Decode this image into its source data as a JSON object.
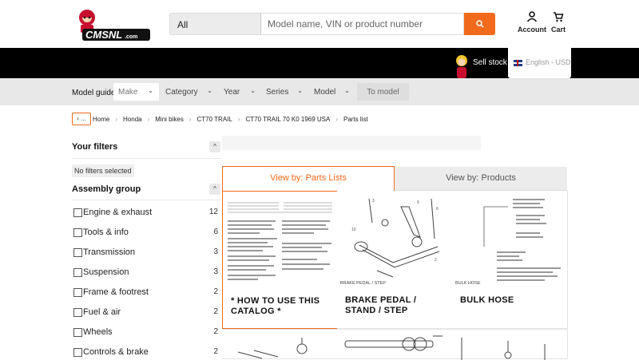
{
  "header": {
    "logo_text": "CMSNL.com",
    "search": {
      "category": "All",
      "placeholder": "Model name, VIN or product number"
    },
    "account_label": "Account",
    "cart_label": "Cart",
    "accent_color": "#f26a1b"
  },
  "topbar": {
    "sell_stock": "Sell stock",
    "language": "English - USD"
  },
  "model_guide": {
    "label": "Model guide",
    "selects": [
      "Make",
      "Category",
      "Year",
      "Series",
      "Model"
    ],
    "to_model": "To model"
  },
  "breadcrumb": {
    "back": "‹ ...",
    "items": [
      "Home",
      "Honda",
      "Mini bikes",
      "CT70 TRAIL",
      "CT70 TRAIL 70 K0 1969 USA",
      "Parts list"
    ]
  },
  "sidebar": {
    "filters_title": "Your filters",
    "no_filters": "No filters selected",
    "assembly_title": "Assembly group",
    "groups": [
      {
        "label": "Engine & exhaust",
        "count": "12"
      },
      {
        "label": "Tools & info",
        "count": "6"
      },
      {
        "label": "Transmission",
        "count": "3"
      },
      {
        "label": "Suspension",
        "count": "3"
      },
      {
        "label": "Frame & footrest",
        "count": "2"
      },
      {
        "label": "Fuel & air",
        "count": "2"
      },
      {
        "label": "Wheels",
        "count": "2"
      },
      {
        "label": "Controls & brake",
        "count": "2"
      }
    ]
  },
  "main": {
    "tabs": {
      "parts_lists": "View by: Parts Lists",
      "products": "View by: Products"
    },
    "cards": [
      {
        "title": "* HOW TO USE THIS CATALOG *",
        "image_caption": ""
      },
      {
        "title": "BRAKE PEDAL / STAND / STEP",
        "image_caption": "BRAKE PEDAL / STEP"
      },
      {
        "title": "BULK HOSE",
        "image_caption": "BULK HOSE"
      }
    ]
  }
}
